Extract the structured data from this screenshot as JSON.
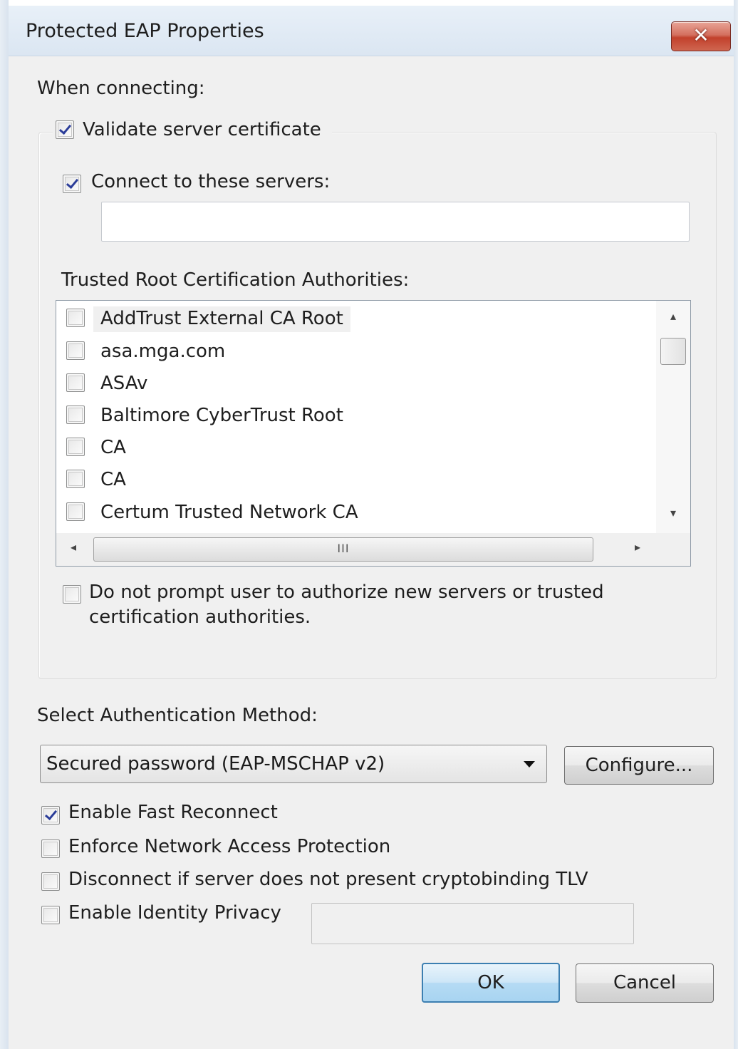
{
  "window": {
    "title": "Protected EAP Properties",
    "close_glyph": "✕"
  },
  "connecting": {
    "heading": "When connecting:",
    "validate_cert": {
      "label": "Validate server certificate",
      "checked": true
    },
    "connect_servers": {
      "label": "Connect to these servers:",
      "checked": true,
      "value": ""
    },
    "trusted_root_label": "Trusted Root Certification Authorities:",
    "ca_list": [
      {
        "label": "AddTrust External CA Root",
        "checked": false
      },
      {
        "label": "asa.mga.com",
        "checked": false
      },
      {
        "label": "ASAv",
        "checked": false
      },
      {
        "label": "Baltimore CyberTrust Root",
        "checked": false
      },
      {
        "label": "CA",
        "checked": false
      },
      {
        "label": "CA",
        "checked": false
      },
      {
        "label": "Certum Trusted Network CA",
        "checked": false
      }
    ],
    "scroll": {
      "up_glyph": "▴",
      "down_glyph": "▾",
      "left_glyph": "◂",
      "right_glyph": "▸",
      "grip_glyph": "III"
    },
    "no_prompt": {
      "line1": "Do not prompt user to authorize new servers or trusted",
      "line2": "certification authorities.",
      "checked": false
    }
  },
  "auth": {
    "label": "Select Authentication Method:",
    "selected": "Secured password (EAP-MSCHAP v2)",
    "configure_label": "Configure..."
  },
  "options": {
    "fast_reconnect": {
      "label": "Enable Fast Reconnect",
      "checked": true
    },
    "nap": {
      "label": "Enforce Network Access Protection",
      "checked": false
    },
    "cryptobinding": {
      "label": "Disconnect if server does not present cryptobinding TLV",
      "checked": false
    },
    "identity_privacy": {
      "label": "Enable Identity Privacy",
      "checked": false,
      "value": ""
    }
  },
  "buttons": {
    "ok": "OK",
    "cancel": "Cancel"
  },
  "colors": {
    "dialog_bg": "#f0f0f0",
    "titlebar": "#dbe6f2",
    "close_red": "#c2412c",
    "check_mark": "#2b3d99",
    "default_button": "#3c7fb1"
  }
}
